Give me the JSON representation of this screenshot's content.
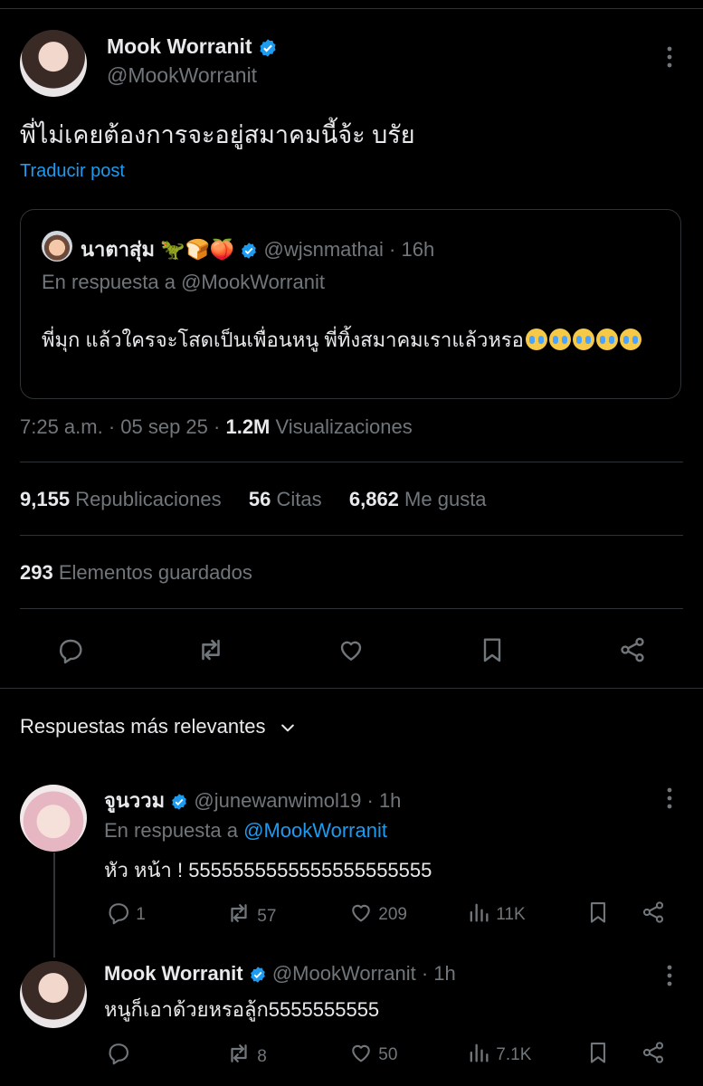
{
  "post": {
    "author_name": "Mook Worranit",
    "author_handle": "@MookWorranit",
    "text": "พี่ไม่เคยต้องการจะอยู่สมาคมนี้จ้ะ บรัย",
    "translate": "Traducir post",
    "timestamp": "7:25 a.m. · 05 sep 25 · ",
    "views_count": "1.2M",
    "views_label": " Visualizaciones",
    "reposts_count": "9,155",
    "reposts_label": "Republicaciones",
    "quotes_count": "56",
    "quotes_label": "Citas",
    "likes_count": "6,862",
    "likes_label": "Me gusta",
    "bookmarks_count": "293",
    "bookmarks_label": "Elementos guardados"
  },
  "quote": {
    "author_name": "นาตาสุ่ม 🦖🍞🍑",
    "author_handle": "@wjsnmathai",
    "time": "· 16h",
    "reply_to": "En respuesta a @MookWorranit",
    "text_line1": "พี่มุก แล้วใครจะโสดเป็นเพื่อนหนู พี่ทิ้งสมาคมเราแล้วหรอ",
    "emoji": "loudly-crying-face"
  },
  "replies_sort": "Respuestas más relevantes",
  "replies": [
    {
      "author_name": "จูนววม",
      "author_handle": "@junewanwimol19",
      "time": "· 1h",
      "reply_prefix": "En respuesta a ",
      "reply_to": "@MookWorranit",
      "text": "หัว หน้า ! 5555555555555555555555",
      "replies": "1",
      "reposts": "57",
      "likes": "209",
      "views": "11K"
    },
    {
      "author_name": "Mook Worranit",
      "author_handle": "@MookWorranit",
      "time": "· 1h",
      "text": "หนูก็เอาด้วยหรอลู้ก5555555555",
      "replies": "",
      "reposts": "8",
      "likes": "50",
      "views": "7.1K"
    }
  ],
  "colors": {
    "background": "#000000",
    "text": "#e7e9ea",
    "secondary": "#71767b",
    "accent": "#1d9bf0",
    "border": "#2f3336"
  }
}
